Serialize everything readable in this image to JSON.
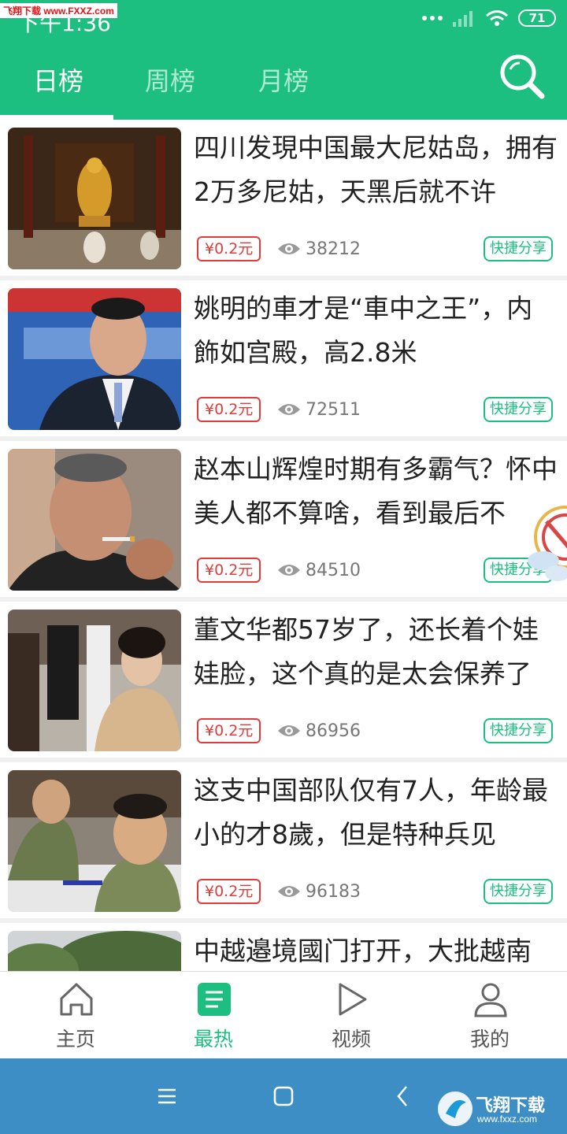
{
  "status": {
    "time": "下午1:36",
    "battery": "71",
    "watermark": "飞翔下载 www.FXXZ.com"
  },
  "tabs": [
    {
      "label": "日榜",
      "active": true
    },
    {
      "label": "周榜",
      "active": false
    },
    {
      "label": "月榜",
      "active": false
    }
  ],
  "items": [
    {
      "title": "四川发現中国最大尼姑岛，拥有2万多尼姑，天黑后就不许",
      "reward": "¥0.2元",
      "views": "38212",
      "share": "快捷分享",
      "image": "temple-photo"
    },
    {
      "title": "姚明的車才是“車中之王”，内飾如宫殿，高2.8米",
      "reward": "¥0.2元",
      "views": "72511",
      "share": "快捷分享",
      "image": "man-in-suit-photo"
    },
    {
      "title": "赵本山辉煌时期有多霸气？怀中美人都不算啥，看到最后不",
      "reward": "¥0.2元",
      "views": "84510",
      "share": "快捷分享",
      "image": "man-smoking-photo"
    },
    {
      "title": "董文华都57岁了，还长着个娃娃脸，这个真的是太会保养了",
      "reward": "¥0.2元",
      "views": "86956",
      "share": "快捷分享",
      "image": "woman-portrait-photo"
    },
    {
      "title": "这支中国部队仅有7人，年龄最小的才8歲，但是特种兵见",
      "reward": "¥0.2元",
      "views": "96183",
      "share": "快捷分享",
      "image": "boy-in-uniform-photo"
    },
    {
      "title": "中越邉境國门打开，大批越南",
      "reward": "",
      "views": "",
      "share": "",
      "image": "street-photo"
    }
  ],
  "bottom_nav": [
    {
      "label": "主页",
      "icon": "home-icon",
      "active": false
    },
    {
      "label": "最热",
      "icon": "hot-list-icon",
      "active": true
    },
    {
      "label": "视频",
      "icon": "play-icon",
      "active": false
    },
    {
      "label": "我的",
      "icon": "profile-icon",
      "active": false
    }
  ],
  "system_nav": {
    "brand": "飞翔下载",
    "brand_url": "www.fxxz.com"
  },
  "colors": {
    "primary": "#1cbf7f",
    "reward": "#e23b3b",
    "system_nav": "#3d8ec5"
  }
}
